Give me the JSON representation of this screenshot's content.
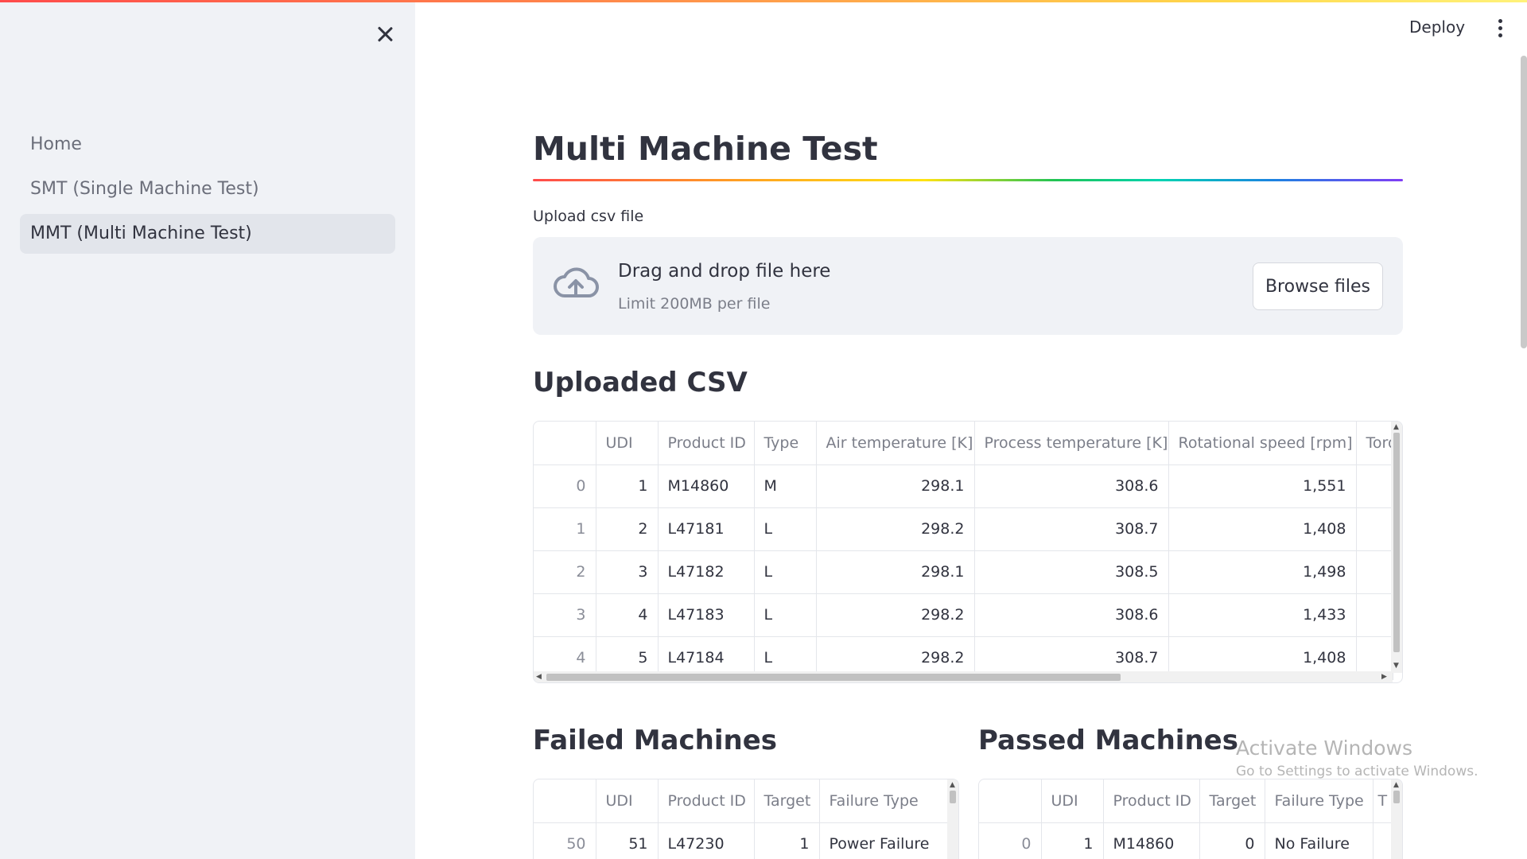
{
  "sidebar": {
    "items": [
      {
        "label": "Home"
      },
      {
        "label": "SMT (Single Machine Test)"
      },
      {
        "label": "MMT (Multi Machine Test)"
      }
    ]
  },
  "header": {
    "deploy_label": "Deploy"
  },
  "main": {
    "title": "Multi Machine Test",
    "upload": {
      "label": "Upload csv file",
      "drop_title": "Drag and drop file here",
      "drop_limit": "Limit 200MB per file",
      "browse_label": "Browse files"
    },
    "uploaded": {
      "heading": "Uploaded CSV",
      "columns": [
        "",
        "UDI",
        "Product ID",
        "Type",
        "Air temperature [K]",
        "Process temperature [K]",
        "Rotational speed [rpm]",
        "Torq"
      ],
      "rows": [
        [
          "0",
          "1",
          "M14860",
          "M",
          "298.1",
          "308.6",
          "1,551",
          ""
        ],
        [
          "1",
          "2",
          "L47181",
          "L",
          "298.2",
          "308.7",
          "1,408",
          ""
        ],
        [
          "2",
          "3",
          "L47182",
          "L",
          "298.1",
          "308.5",
          "1,498",
          ""
        ],
        [
          "3",
          "4",
          "L47183",
          "L",
          "298.2",
          "308.6",
          "1,433",
          ""
        ],
        [
          "4",
          "5",
          "L47184",
          "L",
          "298.2",
          "308.7",
          "1,408",
          ""
        ]
      ]
    },
    "failed": {
      "heading": "Failed Machines",
      "columns": [
        "",
        "UDI",
        "Product ID",
        "Target",
        "Failure Type"
      ],
      "rows": [
        [
          "50",
          "51",
          "L47230",
          "1",
          "Power Failure"
        ]
      ]
    },
    "passed": {
      "heading": "Passed Machines",
      "columns": [
        "",
        "UDI",
        "Product ID",
        "Target",
        "Failure Type",
        "T"
      ],
      "rows": [
        [
          "0",
          "1",
          "M14860",
          "0",
          "No Failure",
          ""
        ]
      ]
    }
  },
  "watermark": {
    "line1": "Activate Windows",
    "line2": "Go to Settings to activate Windows."
  }
}
